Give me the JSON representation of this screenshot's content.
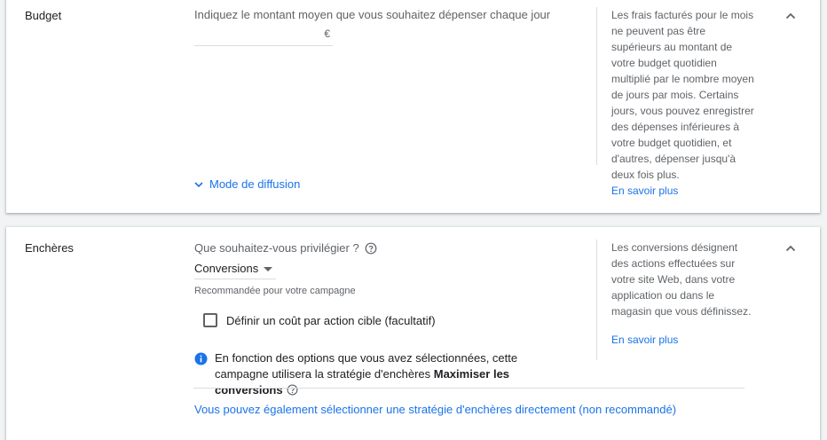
{
  "budget": {
    "title": "Budget",
    "prompt": "Indiquez le montant moyen que vous souhaitez dépenser chaque jour",
    "currency": "€",
    "note": "Les frais facturés pour le mois ne peuvent pas être supérieurs au montant de votre budget quotidien multiplié par le nombre moyen de jours par mois. Certains jours, vous pouvez enregistrer des dépenses inférieures à votre budget quotidien, et d'autres, dépenser jusqu'à deux fois plus.",
    "learn_more": "En savoir plus",
    "delivery_mode": "Mode de diffusion"
  },
  "bids": {
    "title": "Enchères",
    "question": "Que souhaitez-vous privilégier ?",
    "selected": "Conversions",
    "recommended": "Recommandée pour votre campagne",
    "cpa_label": "Définir un coût par action cible (facultatif)",
    "info_text": "En fonction des options que vous avez sélectionnées, cette campagne utilisera la stratégie d'enchères",
    "info_strategy": "Maximiser les conversions",
    "other_strategy": "Vous pouvez également sélectionner une stratégie d'enchères directement (non recommandé)",
    "note": "Les conversions désignent des actions effectuées sur votre site Web, dans votre application ou dans le magasin que vous définissez.",
    "learn_more": "En savoir plus"
  },
  "colors": {
    "link": "#1a73e8",
    "info_icon": "#1a73e8",
    "text_secondary": "#5f6368"
  }
}
